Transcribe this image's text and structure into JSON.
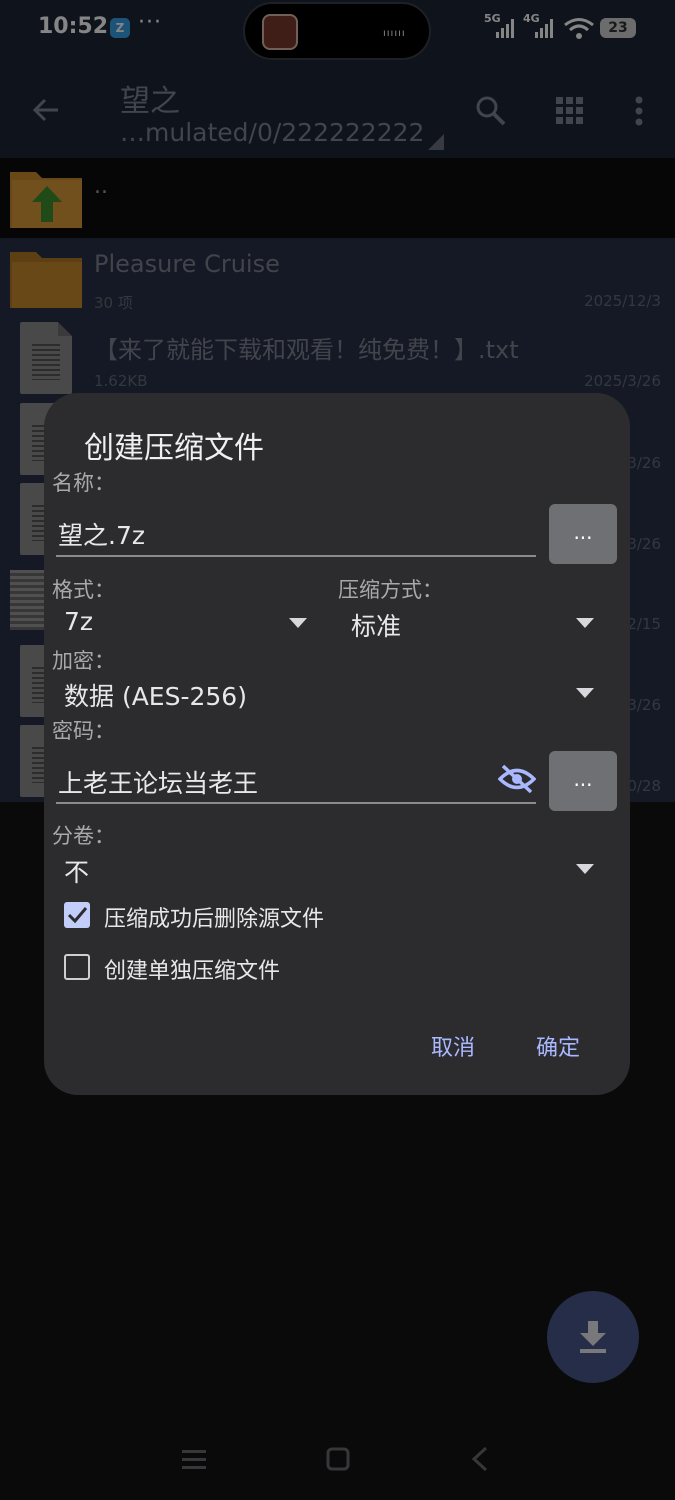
{
  "status_bar": {
    "time": "10:52",
    "app_badge": "Z",
    "more_dots": "···",
    "signal1_label": "5G",
    "signal2_label": "4G",
    "battery": "23"
  },
  "app_bar": {
    "title": "望之",
    "path": "…mulated/0/222222222"
  },
  "file_list": {
    "parent_label": "..",
    "folder": {
      "name": "Pleasure Cruise",
      "meta": "30 项",
      "date": "2025/12/3"
    },
    "file1": {
      "name": "【来了就能下载和观看！纯免费！】.txt",
      "size": "1.62KB",
      "date": "2025/3/26"
    },
    "partial_dates": [
      "3/26",
      "3/26",
      "2/15",
      "3/26",
      "0/28"
    ]
  },
  "dialog": {
    "title": "创建压缩文件",
    "name_label": "名称：",
    "name_value": "望之.7z",
    "more_button": "...",
    "format_label": "格式：",
    "format_value": "7z",
    "method_label": "压缩方式：",
    "method_value": "标准",
    "encrypt_label": "加密：",
    "encrypt_value": "数据 (AES-256)",
    "password_label": "密码：",
    "password_value": "上老王论坛当老王",
    "split_label": "分卷：",
    "split_value": "不",
    "delete_source_label": "压缩成功后删除源文件",
    "delete_source_checked": true,
    "separate_label": "创建单独压缩文件",
    "separate_checked": false,
    "cancel": "取消",
    "ok": "确定"
  },
  "colors": {
    "accent": "#a9b8ff",
    "dialog_bg": "#2c2c2f",
    "checkbox_checked": "#c3cdfa",
    "app_bar_bg": "#1c2537",
    "folder": "#c98a2c",
    "fab": "#48568a"
  },
  "icons": [
    "back-arrow-icon",
    "search-icon",
    "grid-icon",
    "overflow-menu-icon",
    "folder-up-icon",
    "folder-icon",
    "file-icon",
    "eye-off-icon",
    "download-icon",
    "check-icon"
  ]
}
